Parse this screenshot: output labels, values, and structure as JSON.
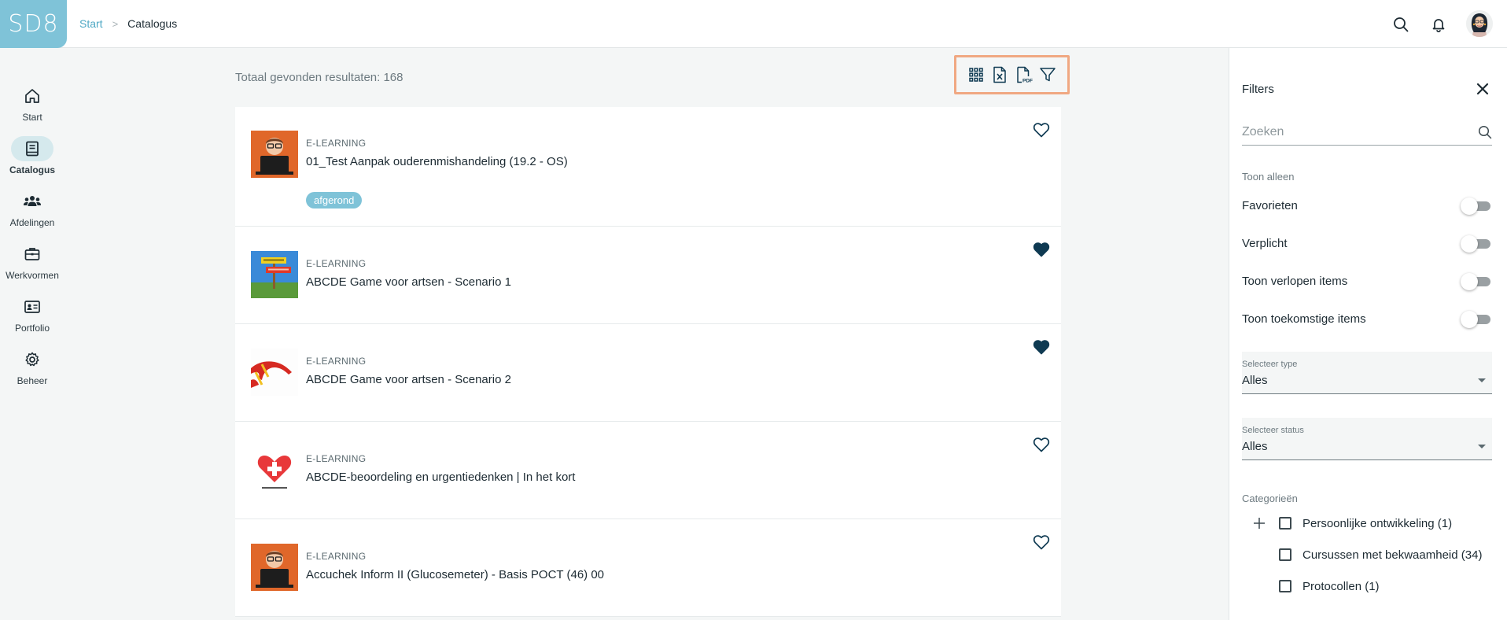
{
  "header": {
    "logo_text": "SD8",
    "breadcrumb": {
      "start": "Start",
      "separator": ">",
      "current": "Catalogus"
    },
    "icons": [
      "search-icon",
      "bell-icon"
    ]
  },
  "nav": {
    "items": [
      {
        "label": "Start",
        "icon": "home-icon",
        "active": false
      },
      {
        "label": "Catalogus",
        "icon": "book-icon",
        "active": true
      },
      {
        "label": "Afdelingen",
        "icon": "group-icon",
        "active": false
      },
      {
        "label": "Werkvormen",
        "icon": "briefcase-icon",
        "active": false
      },
      {
        "label": "Portfolio",
        "icon": "id-card-icon",
        "active": false
      },
      {
        "label": "Beheer",
        "icon": "gear-icon",
        "active": false
      }
    ]
  },
  "main": {
    "results_label": "Totaal gevonden resultaten: 168",
    "items": [
      {
        "type": "E-LEARNING",
        "title": "01_Test Aanpak ouderenmishandeling (19.2 - OS)",
        "badge": "afgerond",
        "favorite": false
      },
      {
        "type": "E-LEARNING",
        "title": "ABCDE Game voor artsen - Scenario 1",
        "favorite": true
      },
      {
        "type": "E-LEARNING",
        "title": "ABCDE Game voor artsen - Scenario 2",
        "favorite": true
      },
      {
        "type": "E-LEARNING",
        "title": "ABCDE-beoordeling en urgentiedenken | In het kort",
        "favorite": false
      },
      {
        "type": "E-LEARNING",
        "title": "Accuchek Inform II (Glucosemeter) - Basis POCT (46) 00",
        "favorite": false
      }
    ]
  },
  "filters": {
    "title": "Filters",
    "search_placeholder": "Zoeken",
    "show_only_label": "Toon alleen",
    "toggles": [
      {
        "label": "Favorieten",
        "on": false
      },
      {
        "label": "Verplicht",
        "on": false
      },
      {
        "label": "Toon verlopen items",
        "on": false
      },
      {
        "label": "Toon toekomstige items",
        "on": false
      }
    ],
    "type_select": {
      "label": "Selecteer type",
      "value": "Alles"
    },
    "status_select": {
      "label": "Selecteer status",
      "value": "Alles"
    },
    "categories_label": "Categorieën",
    "categories": [
      {
        "label": "Persoonlijke ontwikkeling (1)",
        "expandable": true
      },
      {
        "label": "Cursussen met bekwaamheid (34)",
        "expandable": false
      },
      {
        "label": "Protocollen (1)",
        "expandable": false
      }
    ]
  },
  "colors": {
    "accent": "#7fc3d8",
    "icon_dark": "#0f3a52",
    "highlight_border": "#f0a882"
  }
}
